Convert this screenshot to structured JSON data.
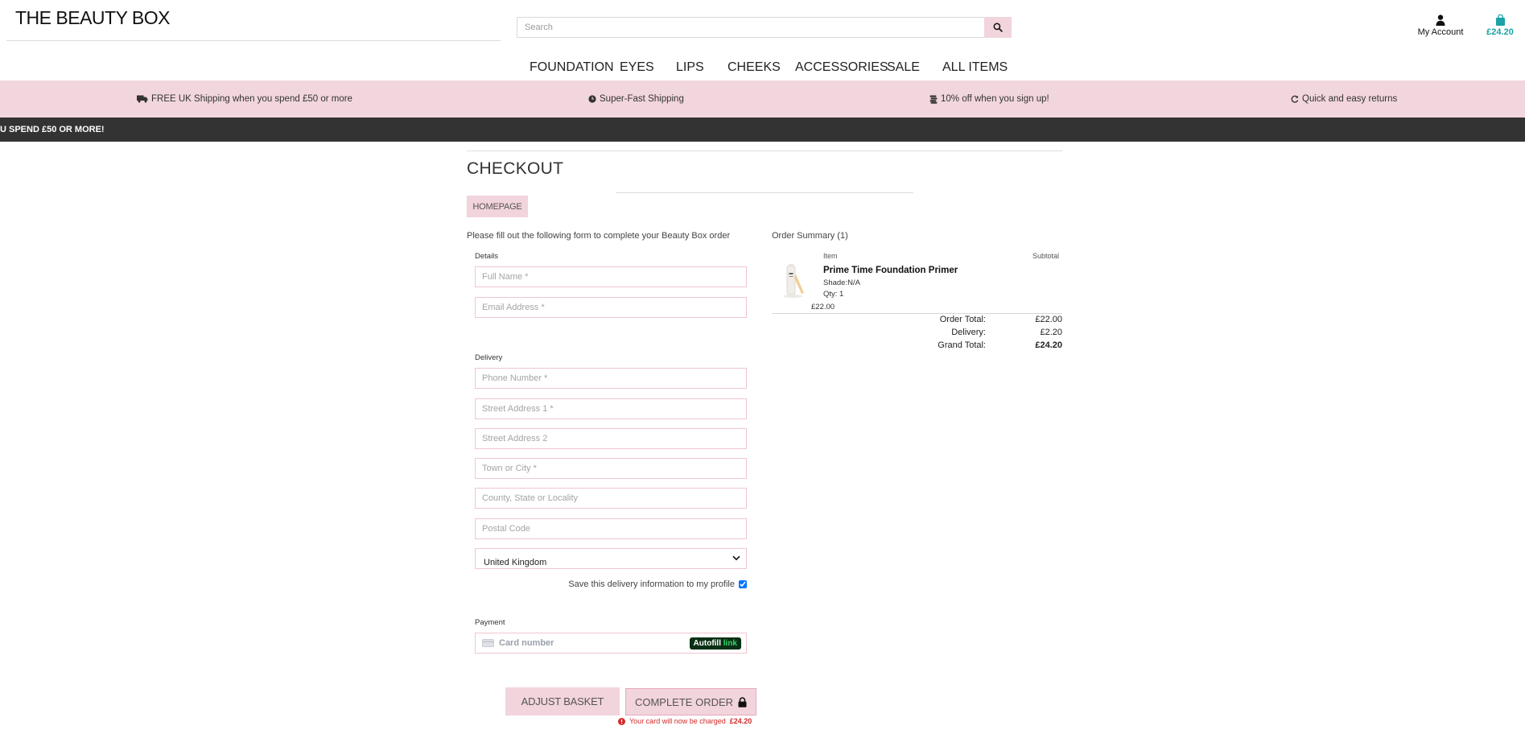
{
  "header": {
    "logo": "THE BEAUTY BOX",
    "search_placeholder": "Search",
    "account_label": "My Account",
    "basket_total": "£24.20"
  },
  "nav": [
    "FOUNDATION",
    "EYES",
    "LIPS",
    "CHEEKS",
    "ACCESSORIES",
    "SALE",
    "ALL ITEMS"
  ],
  "promo": {
    "items": [
      "FREE UK Shipping when you spend £50 or more",
      "Super-Fast Shipping",
      "10% off when you sign up!",
      "Quick and easy returns"
    ],
    "ticker": "U SPEND £50 OR MORE!"
  },
  "checkout": {
    "title": "CHECKOUT",
    "homepage_button": "HOMEPAGE",
    "intro": "Please fill out the following form to complete your Beauty Box order",
    "details_label": "Details",
    "full_name_placeholder": "Full Name *",
    "email_placeholder": "Email Address *",
    "delivery_label": "Delivery",
    "phone_placeholder": "Phone Number *",
    "street1_placeholder": "Street Address 1 *",
    "street2_placeholder": "Street Address 2",
    "town_placeholder": "Town or City *",
    "county_placeholder": "County, State or Locality",
    "postcode_placeholder": "Postal Code",
    "country_selected": "United Kingdom",
    "save_info_label": "Save this delivery information to my profile",
    "save_info_checked": true,
    "payment_label": "Payment",
    "card_placeholder": "Card number",
    "autofill_text": "Autofill",
    "autofill_link": "link",
    "adjust_button": "ADJUST BASKET",
    "complete_button": "COMPLETE ORDER",
    "charge_text": "Your card will now be charged",
    "charge_amount": "£24.20"
  },
  "summary": {
    "title": "Order Summary (1)",
    "col_item": "Item",
    "col_subtotal": "Subtotal",
    "product_name": "Prime Time Foundation Primer",
    "product_shade": "Shade:N/A",
    "product_qty": "Qty: 1",
    "product_price": "£22.00",
    "order_total_label": "Order Total:",
    "order_total": "£22.00",
    "delivery_label": "Delivery:",
    "delivery": "£2.20",
    "grand_total_label": "Grand Total:",
    "grand_total": "£24.20"
  },
  "colors": {
    "accent_pink": "#f2d6dd",
    "dark_bar": "#333333",
    "basket_teal": "#1aa3a8",
    "error_red": "#d22a2a"
  }
}
